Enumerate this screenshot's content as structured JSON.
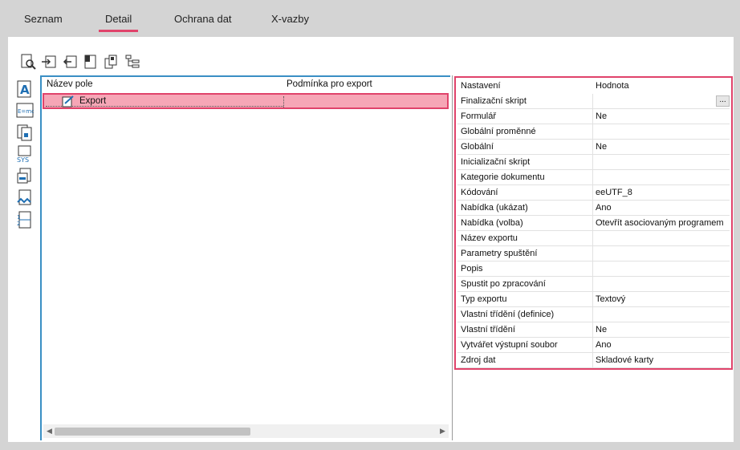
{
  "tabs": [
    {
      "label": "Seznam"
    },
    {
      "label": "Detail"
    },
    {
      "label": "Ochrana dat"
    },
    {
      "label": "X-vazby"
    }
  ],
  "tree": {
    "columns": [
      "Název pole",
      "Podmínka pro export"
    ],
    "rows": [
      {
        "name": "Export",
        "condition": ""
      }
    ]
  },
  "properties": {
    "header": {
      "key": "Nastavení",
      "value": "Hodnota"
    },
    "ellipsis": "...",
    "rows": [
      {
        "key": "Finalizační skript",
        "value": ""
      },
      {
        "key": "Formulář",
        "value": "Ne"
      },
      {
        "key": "Globální proměnné",
        "value": ""
      },
      {
        "key": "Globální",
        "value": "Ne"
      },
      {
        "key": "Inicializační skript",
        "value": ""
      },
      {
        "key": "Kategorie dokumentu",
        "value": ""
      },
      {
        "key": "Kódování",
        "value": "eeUTF_8"
      },
      {
        "key": "Nabídka (ukázat)",
        "value": "Ano"
      },
      {
        "key": "Nabídka (volba)",
        "value": "Otevřít asociovaným programem"
      },
      {
        "key": "Název exportu",
        "value": ""
      },
      {
        "key": "Parametry spuštění",
        "value": ""
      },
      {
        "key": "Popis",
        "value": ""
      },
      {
        "key": "Spustit po zpracování",
        "value": ""
      },
      {
        "key": "Typ exportu",
        "value": "Textový"
      },
      {
        "key": "Vlastní třídění (definice)",
        "value": ""
      },
      {
        "key": "Vlastní třídění",
        "value": "Ne"
      },
      {
        "key": "Vytvářet výstupní soubor",
        "value": "Ano"
      },
      {
        "key": "Zdroj dat",
        "value": "Skladové karty"
      }
    ]
  },
  "colors": {
    "accent": "#e0436b",
    "selection": "#f6a6b6",
    "panel_border": "#3a8fc4"
  }
}
